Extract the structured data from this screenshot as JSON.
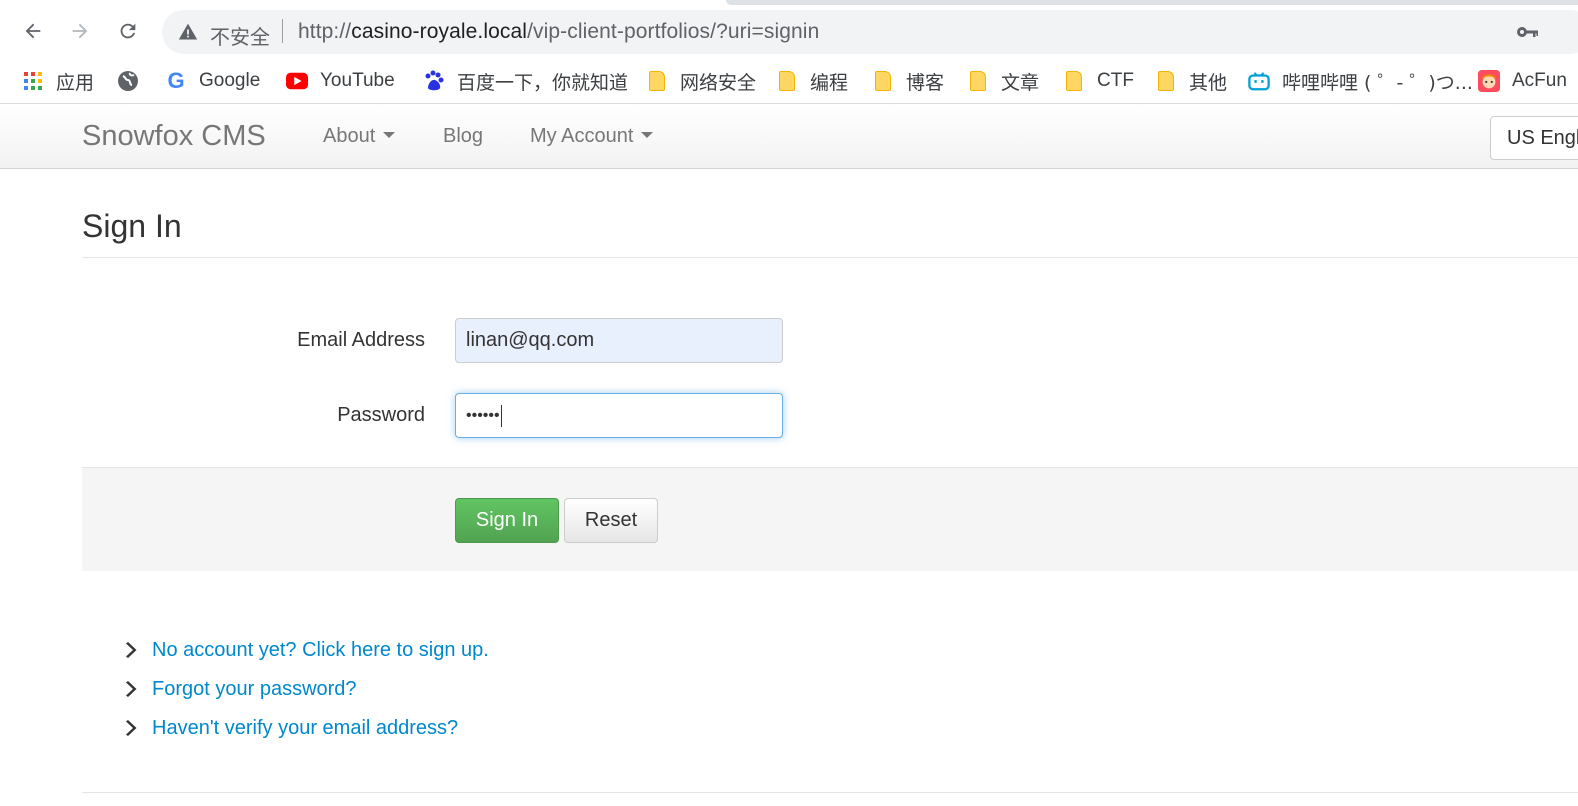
{
  "browser": {
    "security_label": "不安全",
    "url_scheme": "http://",
    "url_host": "casino-royale.local",
    "url_path": "/vip-client-portfolios/?uri=signin",
    "icons": [
      "back-icon",
      "forward-icon",
      "reload-icon",
      "warning-icon",
      "key-icon"
    ]
  },
  "bookmarks": [
    {
      "label": "应用",
      "icon": "apps-grid-icon"
    },
    {
      "label": "",
      "icon": "globe-icon"
    },
    {
      "label": "Google",
      "icon": "google-icon"
    },
    {
      "label": "YouTube",
      "icon": "youtube-icon"
    },
    {
      "label": "百度一下，你就知道",
      "icon": "baidu-icon"
    },
    {
      "label": "网络安全",
      "icon": "folder-icon"
    },
    {
      "label": "编程",
      "icon": "folder-icon"
    },
    {
      "label": "博客",
      "icon": "folder-icon"
    },
    {
      "label": "文章",
      "icon": "folder-icon"
    },
    {
      "label": "CTF",
      "icon": "folder-icon"
    },
    {
      "label": "其他",
      "icon": "folder-icon"
    },
    {
      "label": "哔哩哔哩 ( ゜- ゜)つ...",
      "icon": "bilibili-icon"
    },
    {
      "label": "AcFun",
      "icon": "acfun-icon"
    }
  ],
  "navbar": {
    "brand": "Snowfox CMS",
    "about": "About",
    "blog": "Blog",
    "account": "My Account",
    "language": "US English"
  },
  "page": {
    "title": "Sign In"
  },
  "form": {
    "email_label": "Email Address",
    "email_value": "linan@qq.com",
    "password_label": "Password",
    "password_value": "••••••",
    "signin_label": "Sign In",
    "reset_label": "Reset"
  },
  "links": {
    "signup": "No account yet? Click here to sign up.",
    "forgot": "Forgot your password?",
    "verify": "Haven't verify your email address?"
  },
  "colors": {
    "link": "#0088cc",
    "success": "#51a351",
    "autofill": "#e8f0fe",
    "focus": "#66afe9"
  }
}
